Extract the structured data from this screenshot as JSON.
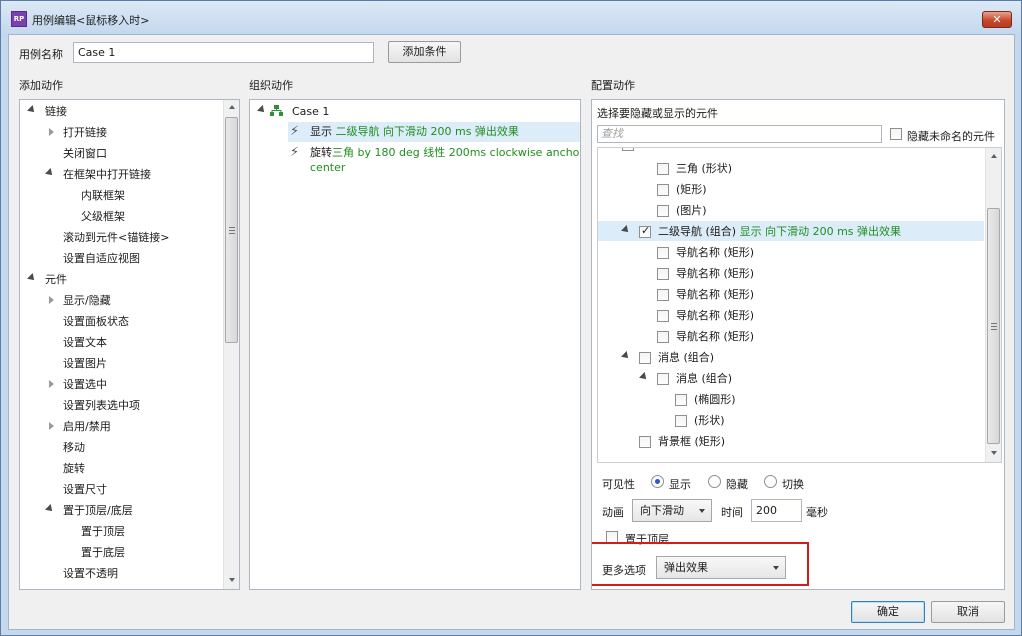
{
  "window": {
    "title": "用例编辑<鼠标移入时>",
    "app_icon_text": "RP"
  },
  "case_name": {
    "label": "用例名称",
    "value": "Case 1",
    "add_condition_label": "添加条件"
  },
  "add_actions": {
    "heading": "添加动作",
    "items": [
      {
        "label": "链接"
      },
      {
        "label": "打开链接"
      },
      {
        "label": "关闭窗口"
      },
      {
        "label": "在框架中打开链接"
      },
      {
        "label": "内联框架"
      },
      {
        "label": "父级框架"
      },
      {
        "label": "滚动到元件<锚链接>"
      },
      {
        "label": "设置自适应视图"
      },
      {
        "label": "元件"
      },
      {
        "label": "显示/隐藏"
      },
      {
        "label": "设置面板状态"
      },
      {
        "label": "设置文本"
      },
      {
        "label": "设置图片"
      },
      {
        "label": "设置选中"
      },
      {
        "label": "设置列表选中项"
      },
      {
        "label": "启用/禁用"
      },
      {
        "label": "移动"
      },
      {
        "label": "旋转"
      },
      {
        "label": "设置尺寸"
      },
      {
        "label": "置于顶层/底层"
      },
      {
        "label": "置于顶层"
      },
      {
        "label": "置于底层"
      },
      {
        "label": "设置不透明"
      }
    ]
  },
  "organize_actions": {
    "heading": "组织动作",
    "case_label": "Case 1",
    "actions": [
      {
        "verb": "显示",
        "detail": "二级导航 向下滑动 200 ms 弹出效果"
      },
      {
        "verb": "旋转",
        "detail_line1": "三角 by 180 deg 线性 200ms clockwise anchor",
        "detail_line2": "center"
      }
    ]
  },
  "config": {
    "heading": "配置动作",
    "subheading": "选择要隐藏或显示的元件",
    "search_placeholder": "查找",
    "hide_unnamed_label": "隐藏未命名的元件",
    "tree": [
      {
        "label": "三角 (形状)",
        "checked": false
      },
      {
        "label": "(矩形)",
        "checked": false
      },
      {
        "label": "(图片)",
        "checked": false
      },
      {
        "label": "二级导航 (组合)",
        "checked": true,
        "action": "显示 向下滑动 200 ms 弹出效果"
      },
      {
        "label": "导航名称 (矩形)",
        "checked": false
      },
      {
        "label": "导航名称 (矩形)",
        "checked": false
      },
      {
        "label": "导航名称 (矩形)",
        "checked": false
      },
      {
        "label": "导航名称 (矩形)",
        "checked": false
      },
      {
        "label": "导航名称 (矩形)",
        "checked": false
      },
      {
        "label": "消息 (组合)",
        "checked": false
      },
      {
        "label": "消息 (组合)",
        "checked": false
      },
      {
        "label": "(椭圆形)",
        "checked": false
      },
      {
        "label": "(形状)",
        "checked": false
      },
      {
        "label": "背景框 (矩形)",
        "checked": false
      }
    ],
    "visibility": {
      "label": "可见性",
      "options": [
        "显示",
        "隐藏",
        "切换"
      ],
      "selected": "显示"
    },
    "animation": {
      "label": "动画",
      "value": "向下滑动",
      "time_label": "时间",
      "time_value": "200",
      "unit": "毫秒"
    },
    "bring_to_front_label": "置于顶层",
    "more_options": {
      "label": "更多选项",
      "value": "弹出效果"
    }
  },
  "footer": {
    "ok_label": "确定",
    "cancel_label": "取消"
  }
}
